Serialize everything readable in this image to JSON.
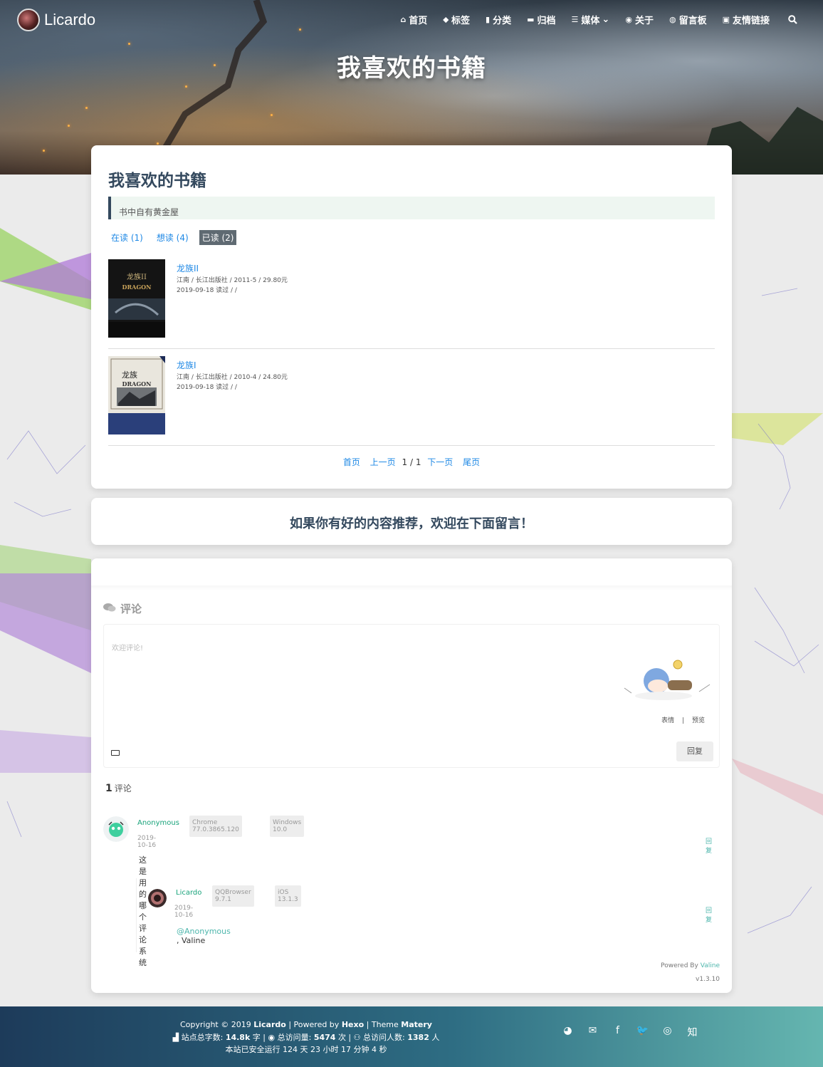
{
  "site": {
    "brand": "Licardo"
  },
  "nav": {
    "items": [
      {
        "label": "首页",
        "icon": "home-icon",
        "glyph": "⌂"
      },
      {
        "label": "标签",
        "icon": "tags-icon",
        "glyph": "⬥"
      },
      {
        "label": "分类",
        "icon": "bookmark-icon",
        "glyph": "▮"
      },
      {
        "label": "归档",
        "icon": "archive-icon",
        "glyph": "▬"
      },
      {
        "label": "媒体",
        "icon": "list-icon",
        "glyph": "☰",
        "caret": "⌄"
      },
      {
        "label": "关于",
        "icon": "user-circle-icon",
        "glyph": "◉"
      },
      {
        "label": "留言板",
        "icon": "comments-icon",
        "glyph": "◍"
      },
      {
        "label": "友情链接",
        "icon": "address-book-icon",
        "glyph": "▣"
      }
    ],
    "search_icon": "search-icon"
  },
  "hero": {
    "title": "我喜欢的书籍"
  },
  "main": {
    "title": "我喜欢的书籍",
    "quote": "书中自有黄金屋",
    "tabs": [
      {
        "label": "在读 (1)",
        "active": false
      },
      {
        "label": "想读 (4)",
        "active": false
      },
      {
        "label": "已读 (2)",
        "active": true
      }
    ],
    "books": [
      {
        "title": "龙族II",
        "meta": "江南 / 长江出版社 / 2011-5 / 29.80元",
        "read": "2019-09-18 读过 / /",
        "cover_word": "龙族II",
        "cover_sub": "DRAGON"
      },
      {
        "title": "龙族I",
        "meta": "江南 / 长江出版社 / 2010-4 / 24.80元",
        "read": "2019-09-18 读过 / /",
        "cover_word": "龙族",
        "cover_sub": "DRAGON"
      }
    ],
    "pager": {
      "first": "首页",
      "prev": "上一页",
      "current": "1 / 1",
      "next": "下一页",
      "last": "尾页"
    }
  },
  "recommend": {
    "text": "如果你有好的内容推荐，欢迎在下面留言！"
  },
  "comments": {
    "heading": "评论",
    "placeholder": "欢迎评论!",
    "tool_emoji": "表情",
    "tool_sep": "|",
    "tool_preview": "预览",
    "reply_button": "回复",
    "count_num": "1",
    "count_label": "评论",
    "list": [
      {
        "name": "Anonymous",
        "tags": [
          "Chrome 77.0.3865.120",
          "Windows 10.0"
        ],
        "date": "2019-10-16",
        "reply": "回复",
        "body": "这是用的哪个评论系统",
        "children": [
          {
            "name": "Licardo",
            "tags": [
              "QQBrowser 9.7.1",
              "iOS 13.1.3"
            ],
            "date": "2019-10-16",
            "reply": "回复",
            "at": "@Anonymous",
            "body": " , Valine"
          }
        ]
      }
    ],
    "powered_by": "Powered By",
    "powered_link": "Valine",
    "version": "v1.3.10"
  },
  "footer": {
    "line1_copy": "Copyright © 2019",
    "line1_name": "Licardo",
    "line1_powered": "| Powered by",
    "line1_hexo": "Hexo",
    "line1_theme": "| Theme",
    "line1_matery": "Matery",
    "line2_words_label": "站点总字数:",
    "line2_words": "14.8k",
    "line2_words_unit": "字 |",
    "line2_views_label": "总访问量:",
    "line2_views": "5474",
    "line2_views_unit": "次 |",
    "line2_visitors_label": "总访问人数:",
    "line2_visitors": "1382",
    "line2_visitors_unit": "人",
    "line3": "本站已安全运行 124 天 23 小时 17 分钟 4 秒",
    "social": [
      {
        "icon": "github-icon",
        "glyph": "◕"
      },
      {
        "icon": "email-icon",
        "glyph": "✉"
      },
      {
        "icon": "facebook-icon",
        "glyph": "f"
      },
      {
        "icon": "twitter-icon",
        "glyph": "🐦"
      },
      {
        "icon": "weibo-icon",
        "glyph": "◎"
      },
      {
        "icon": "zhihu-icon",
        "glyph": "知"
      }
    ]
  }
}
